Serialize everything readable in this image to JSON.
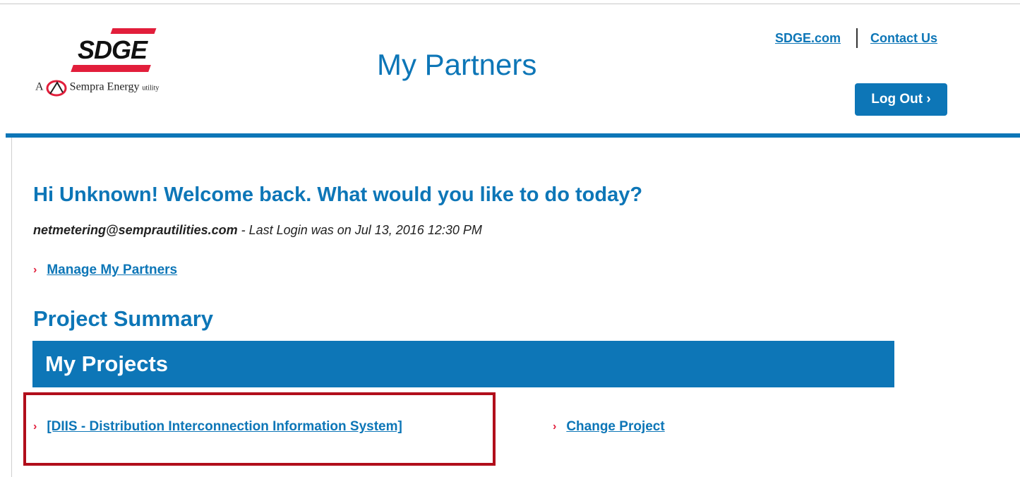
{
  "header": {
    "logo_text": "SDGE",
    "logo_tagline_a": "A",
    "logo_tagline_brand": "Sempra Energy",
    "logo_tagline_suffix": "utility",
    "title": "My Partners",
    "links": [
      {
        "label": "SDGE.com"
      },
      {
        "label": "Contact Us"
      }
    ],
    "logout_label": "Log Out ›"
  },
  "main": {
    "welcome": "Hi Unknown! Welcome back. What would you like to do today?",
    "login_email": "netmetering@semprautilities.com",
    "login_text": " - Last Login was on Jul 13, 2016 12:30 PM",
    "manage_link": "Manage My Partners",
    "section_title": "Project Summary",
    "projects_header": "My Projects",
    "project_link": "[DIIS - Distribution Interconnection Information System]",
    "change_link": "Change Project"
  },
  "colors": {
    "brand_blue": "#0d76b7",
    "brand_red": "#e21e3b",
    "highlight_red": "#b10e1b"
  }
}
